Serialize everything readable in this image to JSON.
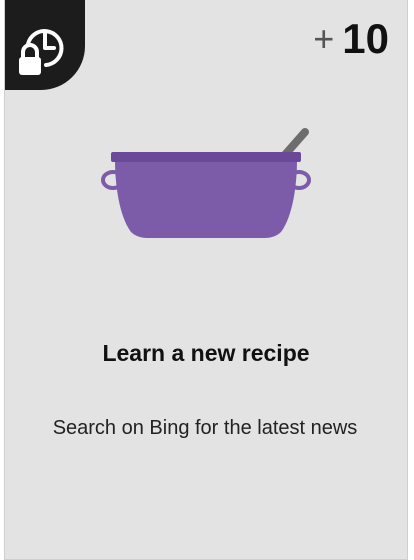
{
  "card": {
    "points_prefix": "+",
    "points": "10",
    "title": "Learn a new recipe",
    "description": "Search on Bing for the latest news",
    "status_icon": "lock-clock-icon",
    "illustration_icon": "cooking-pot-icon",
    "colors": {
      "card_background": "#e3e3e3",
      "corner_badge": "#1c1c1c",
      "pot_purple": "#7c5ca8",
      "spoon_gray": "#6d6d6d"
    }
  }
}
